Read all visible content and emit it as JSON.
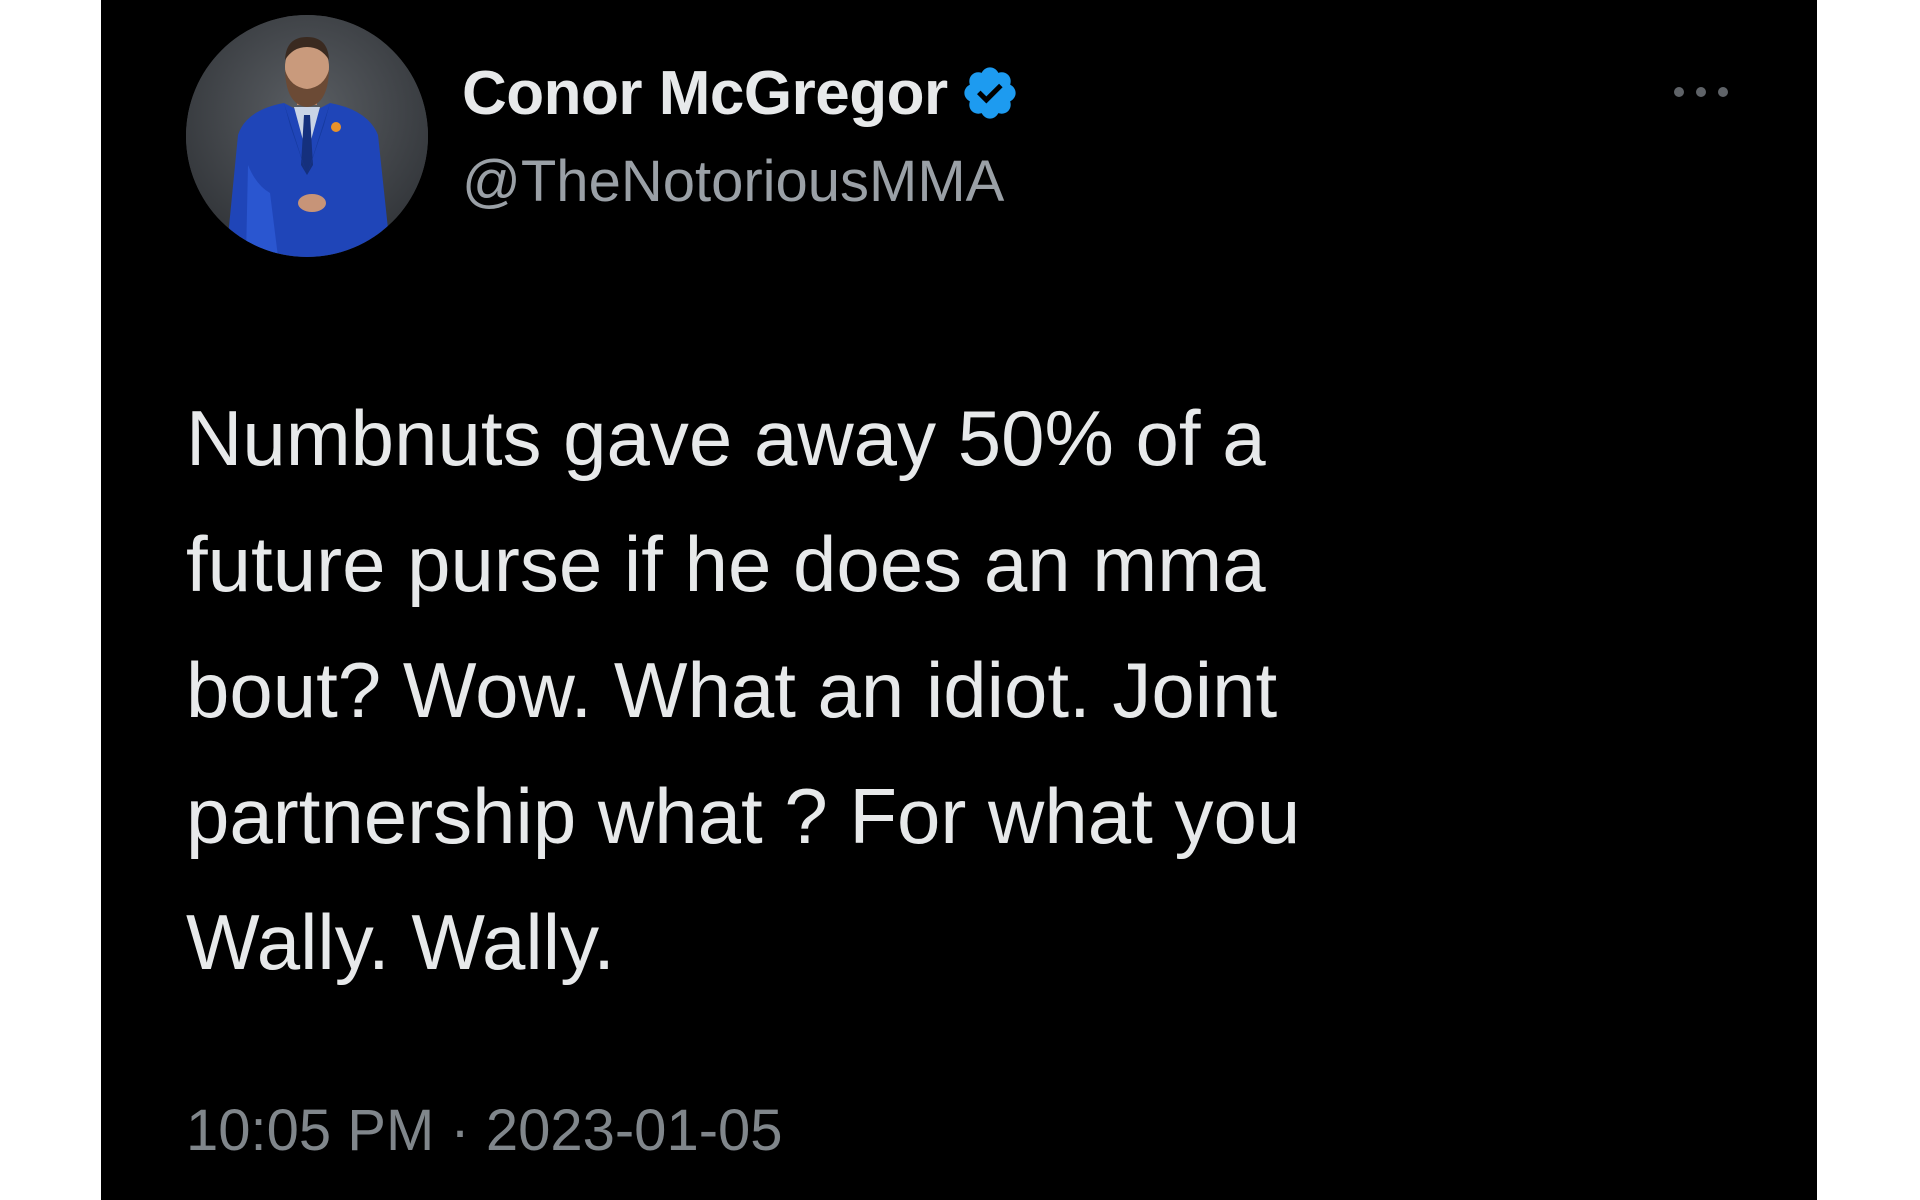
{
  "author": {
    "display_name": "Conor McGregor",
    "handle": "@TheNotoriousMMA",
    "verified": true,
    "avatar_icon": "profile-photo-man-blue-suit"
  },
  "tweet": {
    "text": "Numbnuts gave away 50% of a\nfuture purse if he does an mma\nbout? Wow. What an idiot. Joint\npartnership what ? For what you\nWally. Wally.",
    "time": "10:05 PM",
    "separator": "·",
    "date": "2023-01-05"
  },
  "menu": {
    "icon": "more-horizontal-icon"
  },
  "colors": {
    "background": "#000000",
    "text_primary": "#e7e9ea",
    "text_secondary": "#9aa0a6",
    "verified_badge": "#1d9bf0"
  }
}
